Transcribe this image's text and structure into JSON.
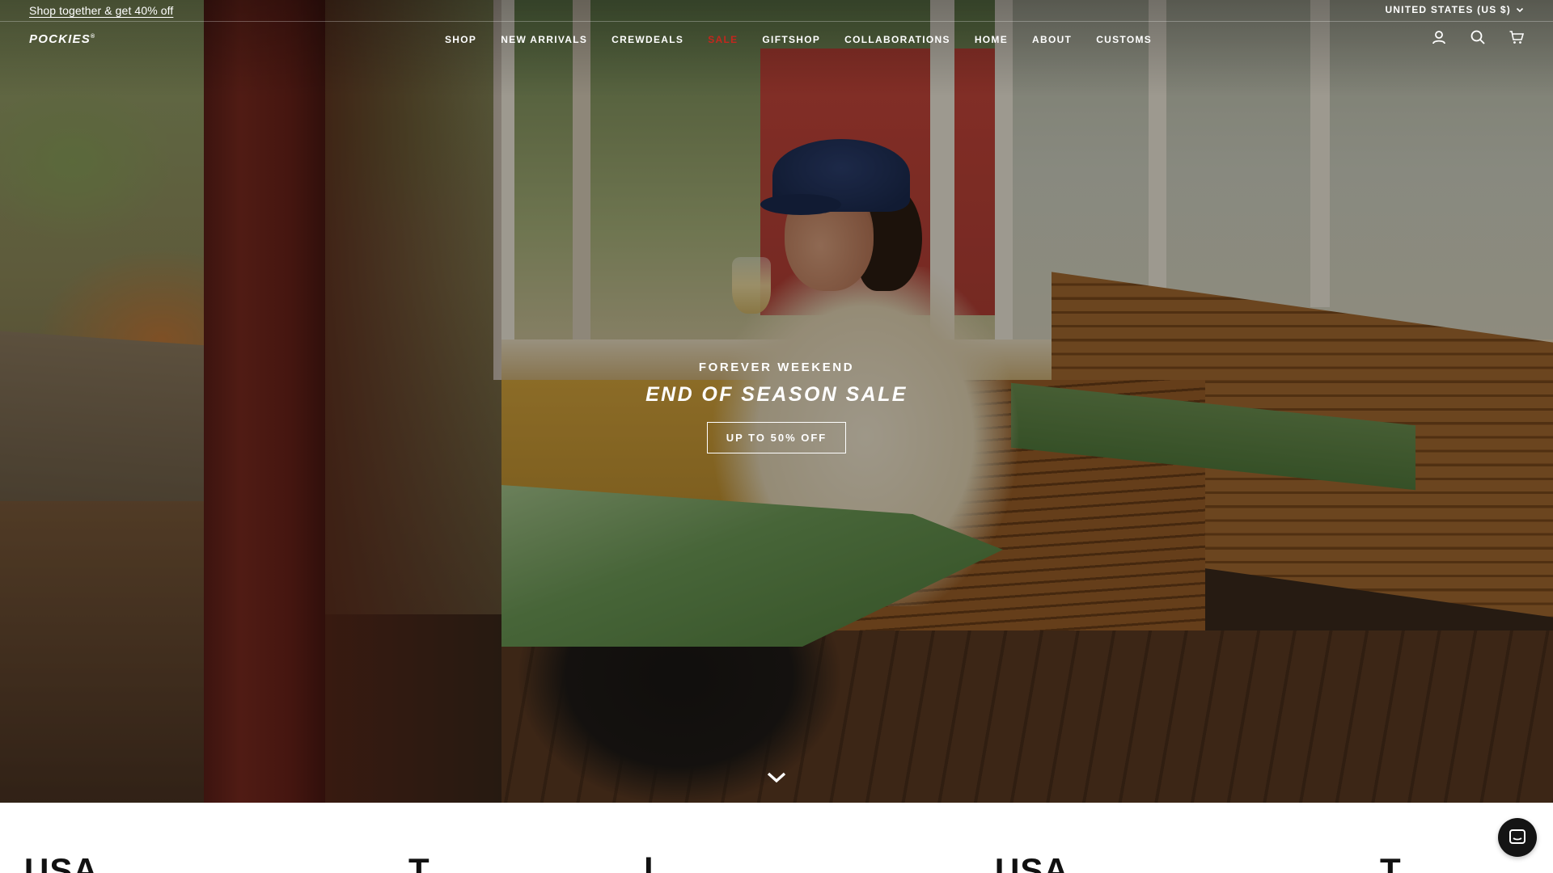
{
  "announcement": {
    "link_text": "Shop together & get 40% off",
    "currency_label": "UNITED STATES (US $)"
  },
  "header": {
    "logo": "POCKIES",
    "logo_mark": "®",
    "nav": [
      {
        "label": "SHOP"
      },
      {
        "label": "NEW ARRIVALS"
      },
      {
        "label": "CREWDEALS"
      },
      {
        "label": "SALE"
      },
      {
        "label": "GIFTSHOP"
      },
      {
        "label": "COLLABORATIONS"
      },
      {
        "label": "HOME"
      },
      {
        "label": "ABOUT"
      },
      {
        "label": "CUSTOMS"
      }
    ],
    "icons": [
      "account-icon",
      "search-icon",
      "cart-icon"
    ]
  },
  "hero": {
    "kicker": "FOREVER WEEKEND",
    "title": "END OF SEASON SALE",
    "cta": "UP TO 50% OFF",
    "scroll_icon": "chevron-down-icon"
  },
  "marquee": {
    "items": [
      "USA",
      "T",
      "l",
      "USA",
      "T"
    ]
  },
  "chat": {
    "icon": "chat-icon"
  },
  "colors": {
    "sale_accent": "#c4261d",
    "text_on_hero": "#ffffff",
    "chat_bg": "#141414"
  }
}
